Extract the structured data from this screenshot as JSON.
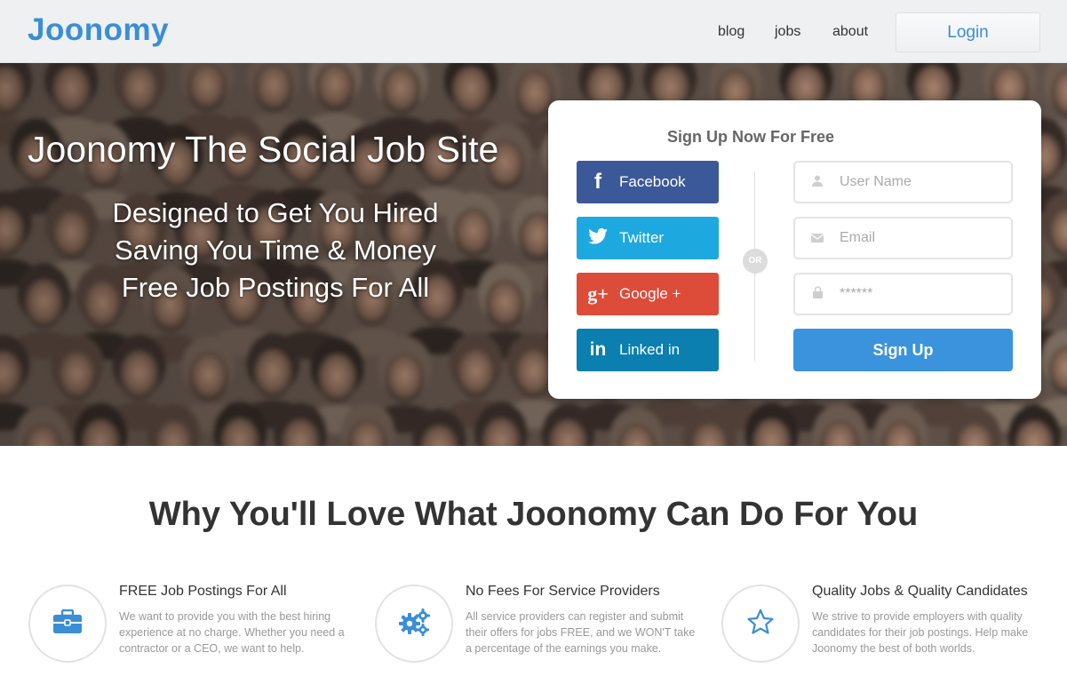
{
  "header": {
    "logo": "Joonomy",
    "nav": [
      "blog",
      "jobs",
      "about"
    ],
    "login_label": "Login"
  },
  "hero": {
    "title": "Joonomy The Social Job Site",
    "subtitle_lines": [
      "Designed to Get You Hired",
      "Saving You Time & Money",
      "Free Job Postings For All"
    ]
  },
  "signup": {
    "title": "Sign Up Now For Free",
    "social": [
      {
        "label": "Facebook",
        "icon": "facebook-icon",
        "glyph": "f",
        "color": "#3b5998"
      },
      {
        "label": "Twitter",
        "icon": "twitter-icon",
        "glyph": "🐦",
        "color": "#1ea8e0"
      },
      {
        "label": "Google +",
        "icon": "google-plus-icon",
        "glyph": "g+",
        "color": "#dd4b39"
      },
      {
        "label": "Linked in",
        "icon": "linkedin-icon",
        "glyph": "in",
        "color": "#0a7fb0"
      }
    ],
    "or_label": "OR",
    "fields": {
      "username_placeholder": "User Name",
      "email_placeholder": "Email",
      "password_placeholder": "******"
    },
    "submit_label": "Sign Up"
  },
  "features": {
    "title": "Why You'll Love What Joonomy Can Do For You",
    "items": [
      {
        "icon": "briefcase-icon",
        "title": "FREE Job Postings For All",
        "text": "We want to provide you with the best hiring experience at no charge. Whether you need a contractor or a CEO, we want to help."
      },
      {
        "icon": "gears-icon",
        "title": "No Fees For Service Providers",
        "text": "All service providers can register and submit their offers for jobs FREE, and we WON'T take a percentage of the earnings you make."
      },
      {
        "icon": "star-icon",
        "title": "Quality Jobs & Quality Candidates",
        "text": "We strive to provide employers with quality candidates for their job postings. Help make Joonomy the best of both worlds."
      }
    ]
  },
  "colors": {
    "brand": "#3a8ed6",
    "signup_button": "#3a93dc"
  }
}
